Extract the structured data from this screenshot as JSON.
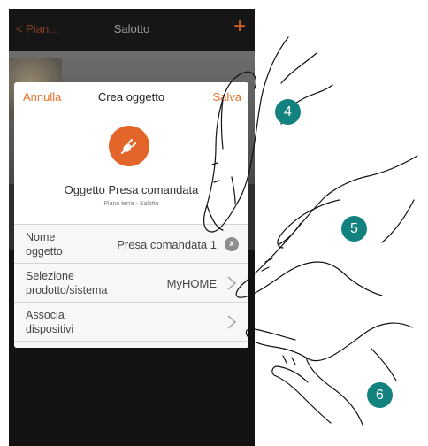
{
  "navbar": {
    "back_label": "< Pian...",
    "title": "Salotto",
    "add_icon": "plus-icon"
  },
  "dialog": {
    "cancel_label": "Annulla",
    "title": "Crea oggetto",
    "save_label": "Salva",
    "object_icon": "plug-icon",
    "object_name": "Oggetto Presa comandata",
    "object_location": "Piano terra - Salotto",
    "rows": [
      {
        "label_line1": "Nome",
        "label_line2": "oggetto",
        "value": "Presa comandata 1",
        "action_icon": "clear-icon"
      },
      {
        "label_line1": "Selezione",
        "label_line2": "prodotto/sistema",
        "value": "MyHOME",
        "action_icon": "chevron-right-icon"
      },
      {
        "label_line1": "Associa",
        "label_line2": "dispositivi",
        "value": "",
        "action_icon": "chevron-right-icon"
      }
    ]
  },
  "steps": [
    "4",
    "5",
    "6"
  ],
  "colors": {
    "accent": "#e4712a",
    "badge": "#13827e",
    "icon_bg": "#e4652a"
  }
}
